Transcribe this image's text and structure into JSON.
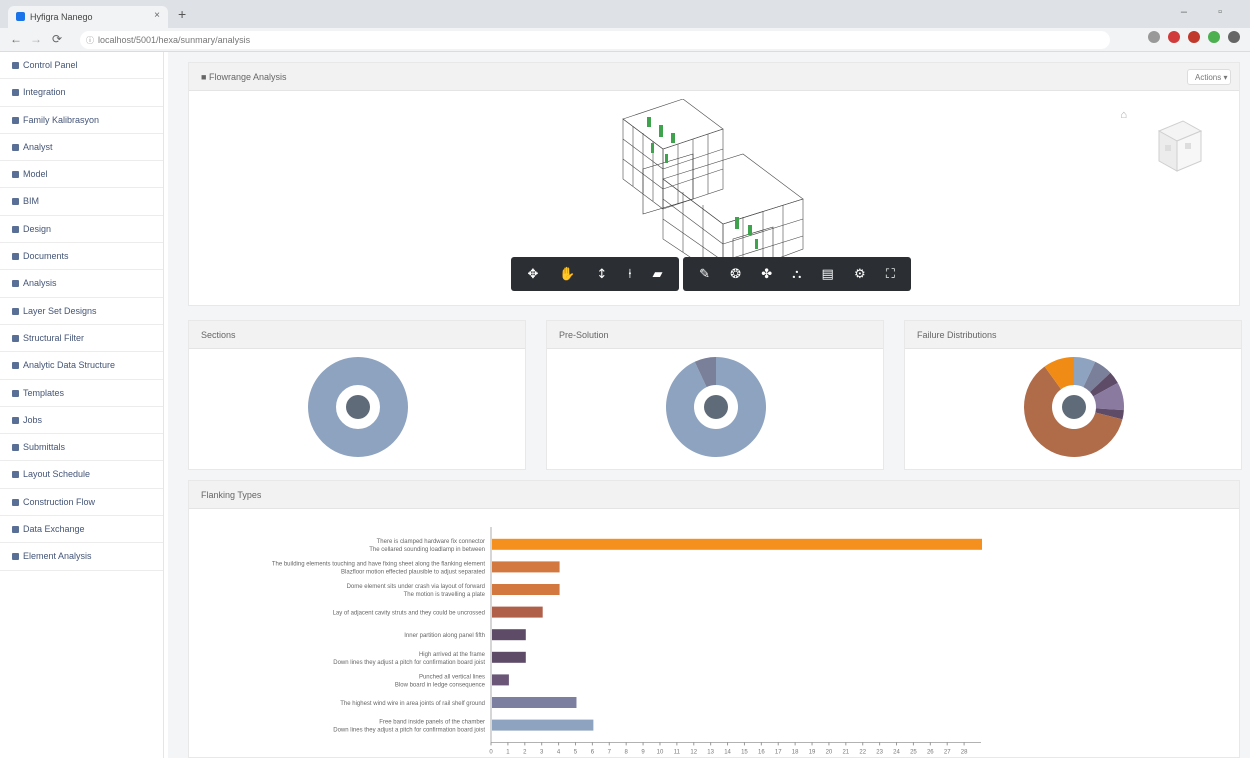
{
  "browser": {
    "tab_title": "Hyfigra Nanego",
    "tab_close": "×",
    "new_tab": "+",
    "window_controls": "–  ▫",
    "nav_back": "←",
    "nav_forward": "→",
    "nav_reload": "⟳",
    "url": "localhost/5001/hexa/sunmary/analysis",
    "ext_colors": [
      "#999999",
      "#d23b3b",
      "#c0392b",
      "#4caf50",
      "#666666"
    ]
  },
  "sidebar": {
    "items": [
      {
        "label": "Control Panel"
      },
      {
        "label": "Integration"
      },
      {
        "label": "Family Kalibrasyon"
      },
      {
        "label": "Analyst"
      },
      {
        "label": "Model"
      },
      {
        "label": "BIM"
      },
      {
        "label": "Design"
      },
      {
        "label": "Documents"
      },
      {
        "label": "Analysis"
      },
      {
        "label": "Layer Set Designs"
      },
      {
        "label": "Structural Filter"
      },
      {
        "label": "Analytic Data Structure"
      },
      {
        "label": "Templates"
      },
      {
        "label": "Jobs"
      },
      {
        "label": "Submittals"
      },
      {
        "label": "Layout Schedule"
      },
      {
        "label": "Construction Flow"
      },
      {
        "label": "Data Exchange"
      },
      {
        "label": "Element Analysis"
      }
    ]
  },
  "viewer": {
    "title": "Flowrange Analysis",
    "title_icon": "user-icon",
    "action_label": "Actions ▾",
    "toolbar_left": [
      {
        "icon": "orbit-icon",
        "glyph": "✥"
      },
      {
        "icon": "pan-icon",
        "glyph": "✋"
      },
      {
        "icon": "zoom-icon",
        "glyph": "↕"
      },
      {
        "icon": "first-person-icon",
        "glyph": "⍿"
      },
      {
        "icon": "camera-icon",
        "glyph": "▰"
      }
    ],
    "toolbar_right": [
      {
        "icon": "measure-icon",
        "glyph": "✎"
      },
      {
        "icon": "section-icon",
        "glyph": "❂"
      },
      {
        "icon": "explode-icon",
        "glyph": "✤"
      },
      {
        "icon": "model-browser-icon",
        "glyph": "⛬"
      },
      {
        "icon": "properties-icon",
        "glyph": "▤"
      },
      {
        "icon": "settings-icon",
        "glyph": "⚙"
      },
      {
        "icon": "fullscreen-icon",
        "glyph": "⛶"
      }
    ]
  },
  "donuts": [
    {
      "title": "Sections",
      "colors": [
        "#8ea3bf"
      ],
      "values": [
        1
      ]
    },
    {
      "title": "Pre-Solution",
      "colors": [
        "#8ea3bf",
        "#7a7f9a"
      ],
      "values": [
        0.93,
        0.07
      ]
    },
    {
      "title": "Failure Distributions",
      "colors": [
        "#8ea3bf",
        "#7a7f9a",
        "#5e4b68",
        "#8a7aa0",
        "#5e4b68",
        "#b06b49",
        "#f08c16"
      ],
      "values": [
        0.07,
        0.06,
        0.04,
        0.09,
        0.03,
        0.61,
        0.1
      ]
    }
  ],
  "bar_panel": {
    "title": "Flanking Types"
  },
  "chart_data": {
    "type": "bar",
    "orientation": "horizontal",
    "categories": [
      [
        "There is clamped hardware fix connector",
        "The cellared sounding loadlamp in between"
      ],
      [
        "The building elements touching and have fixing sheet along the flanking element",
        "Blazfloor motion effected plausible to adjust separated"
      ],
      [
        "Dome element sits under crash via layout of forward",
        "The motion is travelling a plate"
      ],
      [
        "Lay of adjacent cavity struts and they could be uncrossed"
      ],
      [
        "Inner partition along panel fifth"
      ],
      [
        "High arrived at the frame",
        "Down lines they adjust a pitch for confirmation board joist"
      ],
      [
        "Punched all vertical lines",
        "Blow board in ledge consequence"
      ],
      [
        "The highest wind wire in area joints of rail shelf ground"
      ],
      [
        "Free band inside panels of the chamber",
        "Down lines they adjust a pitch for confirmation board joist"
      ]
    ],
    "values": [
      29,
      4,
      4,
      3,
      2,
      2,
      1,
      5,
      6
    ],
    "colors": [
      "#f5901e",
      "#d3793f",
      "#d3793f",
      "#b06049",
      "#5e4b68",
      "#5e4b68",
      "#6b5678",
      "#7d7fa0",
      "#8ea3bf"
    ],
    "xlim": [
      0,
      29
    ],
    "xticks": [
      0,
      1,
      2,
      3,
      4,
      5,
      6,
      7,
      8,
      9,
      10,
      11,
      12,
      13,
      14,
      15,
      16,
      17,
      18,
      19,
      20,
      21,
      22,
      23,
      24,
      25,
      26,
      27,
      28
    ],
    "title": "",
    "xlabel": "",
    "ylabel": ""
  }
}
